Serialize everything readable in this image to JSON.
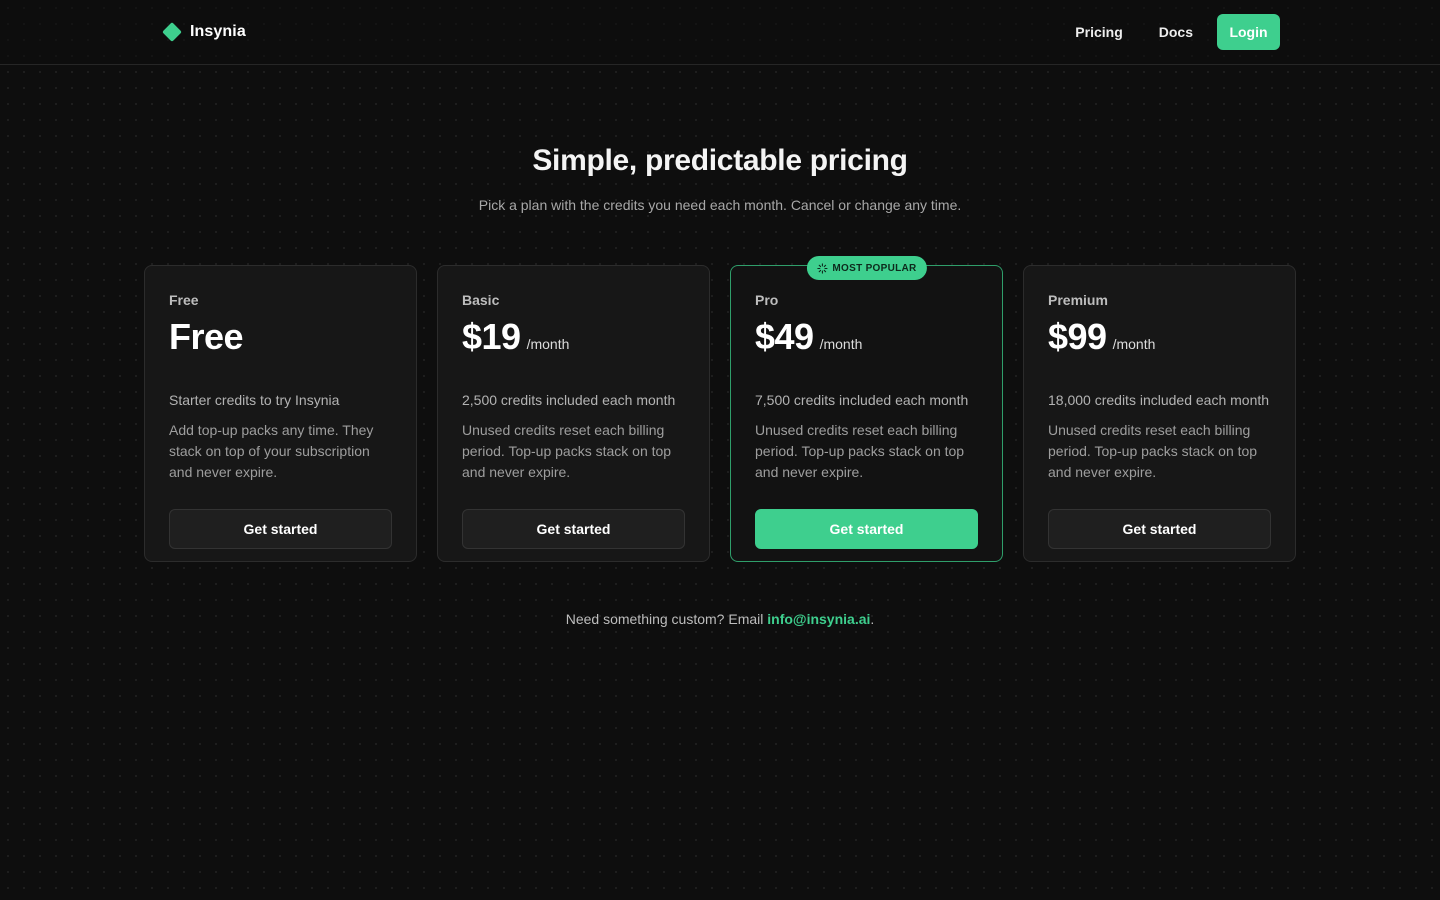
{
  "brand": {
    "name": "Insynia",
    "accent": "#3ecf8e"
  },
  "nav": {
    "pricing": "Pricing",
    "docs": "Docs",
    "login": "Login"
  },
  "hero": {
    "title": "Simple, predictable pricing",
    "subtitle": "Pick a plan with the credits you need each month. Cancel or change any time."
  },
  "plans": [
    {
      "name": "Free",
      "price": "Free",
      "period": "",
      "credits": "Starter credits to try Insynia",
      "description": "Add top-up packs any time. They stack on top of your subscription and never expire.",
      "cta": "Get started"
    },
    {
      "name": "Basic",
      "price": "$19",
      "period": "/month",
      "credits": "2,500 credits included each month",
      "description": "Unused credits reset each billing period. Top-up packs stack on top and never expire.",
      "cta": "Get started"
    },
    {
      "name": "Pro",
      "price": "$49",
      "period": "/month",
      "credits": "7,500 credits included each month",
      "description": "Unused credits reset each billing period. Top-up packs stack on top and never expire.",
      "cta": "Get started",
      "badge": "MOST POPULAR",
      "badge_icon": "sparkle-icon"
    },
    {
      "name": "Premium",
      "price": "$99",
      "period": "/month",
      "credits": "18,000 credits included each month",
      "description": "Unused credits reset each billing period. Top-up packs stack on top and never expire.",
      "cta": "Get started"
    }
  ],
  "footer": {
    "text": "Need something custom? Email ",
    "email": "info@insynia.ai",
    "suffix": "."
  }
}
